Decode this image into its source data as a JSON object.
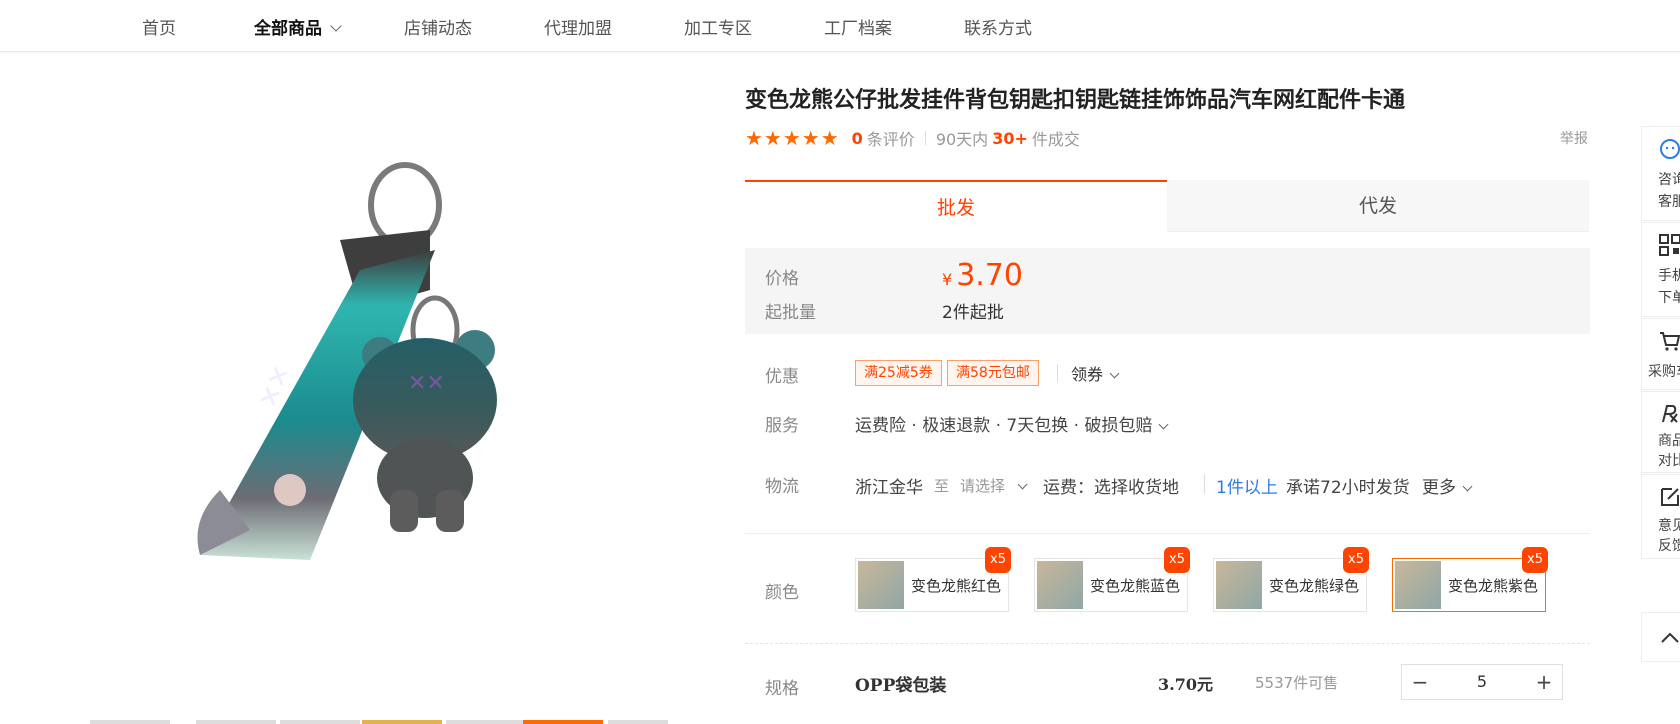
{
  "nav": {
    "items": [
      "首页",
      "全部商品",
      "店铺动态",
      "代理加盟",
      "加工专区",
      "工厂档案",
      "联系方式"
    ]
  },
  "product": {
    "title": "变色龙熊公仔批发挂件背包钥匙扣钥匙链挂饰饰品汽车网红配件卡通",
    "review_count": "0",
    "review_label": "条评价",
    "sales_prefix": "90天内",
    "sales_count": "30+",
    "sales_suffix": "件成交",
    "report": "举报"
  },
  "tabs": {
    "wholesale": "批发",
    "dropship": "代发"
  },
  "price_box": {
    "price_label": "价格",
    "currency": "¥",
    "price": "3.70",
    "moq_label": "起批量",
    "moq": "2件起批"
  },
  "offers": {
    "label": "优惠",
    "coupons": [
      "满25减5券",
      "满58元包邮"
    ],
    "get_coupon": "领券"
  },
  "service": {
    "label": "服务",
    "text": "运费险 · 极速退款 · 7天包换 · 破损包赔"
  },
  "logistics": {
    "label": "物流",
    "origin": "浙江金华",
    "to": "至",
    "select": "请选择",
    "freight": "运费：选择收货地",
    "qty_rule": "1件以上",
    "promise": "承诺72小时发货",
    "more": "更多"
  },
  "color": {
    "label": "颜色",
    "options": [
      {
        "name": "变色龙熊红色",
        "badge": "x5"
      },
      {
        "name": "变色龙熊蓝色",
        "badge": "x5"
      },
      {
        "name": "变色龙熊绿色",
        "badge": "x5"
      },
      {
        "name": "变色龙熊紫色",
        "badge": "x5"
      }
    ],
    "selected_index": 3
  },
  "spec": {
    "label": "规格",
    "name": "OPP袋包装",
    "price": "3.70元",
    "stock": "5537件可售",
    "quantity": "5"
  },
  "sidebar": {
    "items": [
      {
        "icon": "chat-icon",
        "label1": "咨询",
        "label2": "客服"
      },
      {
        "icon": "qr-code-icon",
        "label1": "手机",
        "label2": "下单"
      },
      {
        "icon": "cart-icon",
        "label1": "采购车",
        "label2": ""
      },
      {
        "icon": "compare-icon",
        "label1": "商品",
        "label2": "对比"
      },
      {
        "icon": "edit-icon",
        "label1": "意见",
        "label2": "反馈"
      }
    ]
  },
  "colors": {
    "accent": "#ff4400",
    "blue": "#2d7ae8"
  }
}
